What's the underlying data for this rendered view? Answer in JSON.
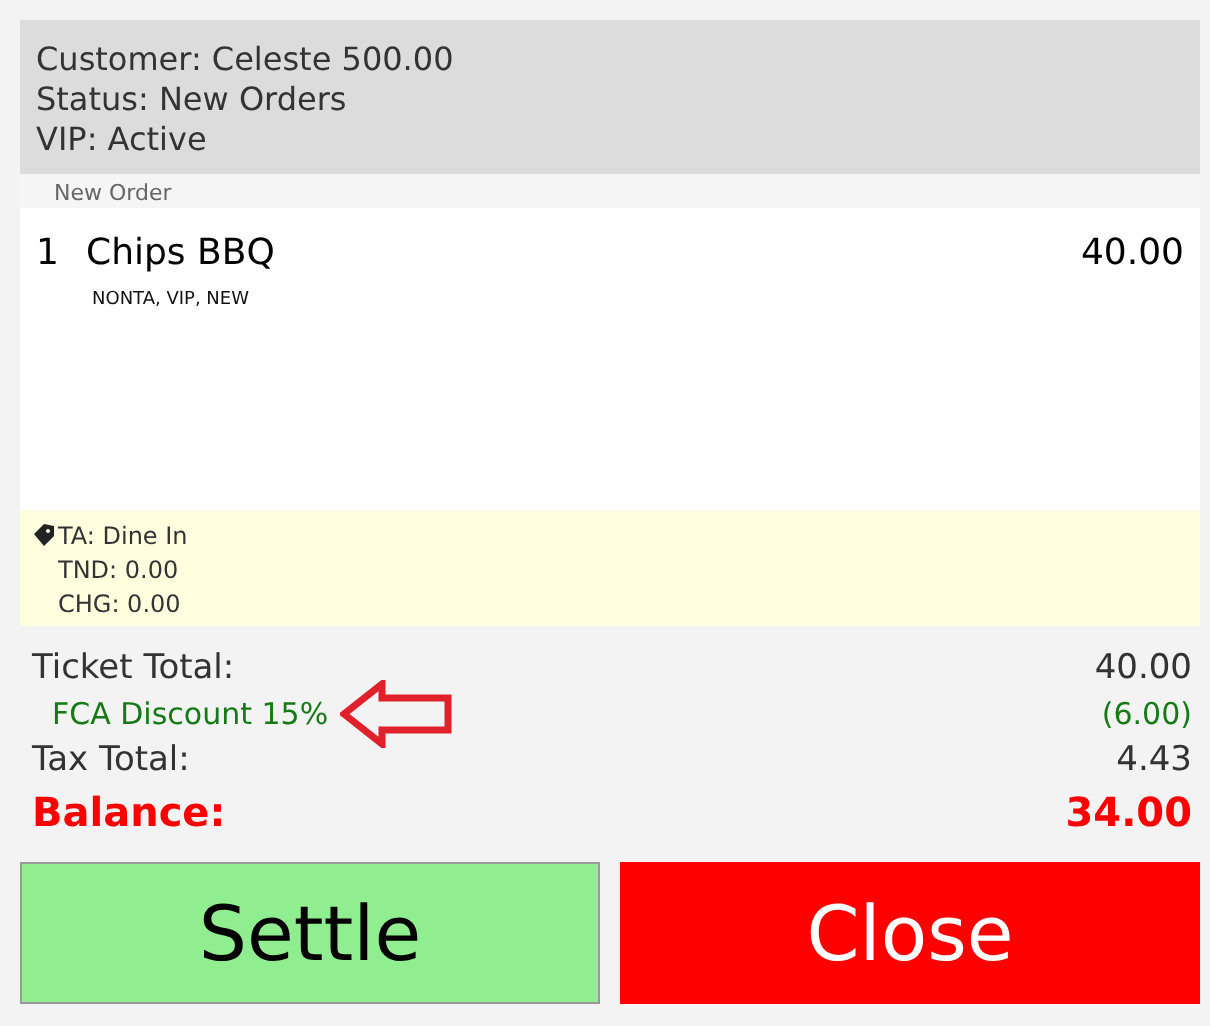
{
  "customer": {
    "lines": [
      "Customer: Celeste 500.00",
      "Status: New Orders",
      "VIP: Active"
    ]
  },
  "order": {
    "group_label": "New Order",
    "items": [
      {
        "quantity": "1",
        "name": "Chips BBQ",
        "tags": "NONTA, VIP, NEW",
        "price": "40.00"
      }
    ]
  },
  "notes": [
    "TA: Dine In",
    "TND: 0.00",
    "CHG: 0.00"
  ],
  "totals": [
    {
      "kind": "normal",
      "label": "Ticket Total:",
      "value": "40.00"
    },
    {
      "kind": "discount",
      "label": "FCA Discount 15%",
      "value": "(6.00)",
      "annotated": true
    },
    {
      "kind": "normal",
      "label": "Tax Total:",
      "value": "4.43"
    },
    {
      "kind": "balance",
      "label": "Balance:",
      "value": "34.00"
    }
  ],
  "buttons": [
    {
      "kind": "settle",
      "label": "Settle"
    },
    {
      "kind": "close",
      "label": "Close"
    }
  ]
}
